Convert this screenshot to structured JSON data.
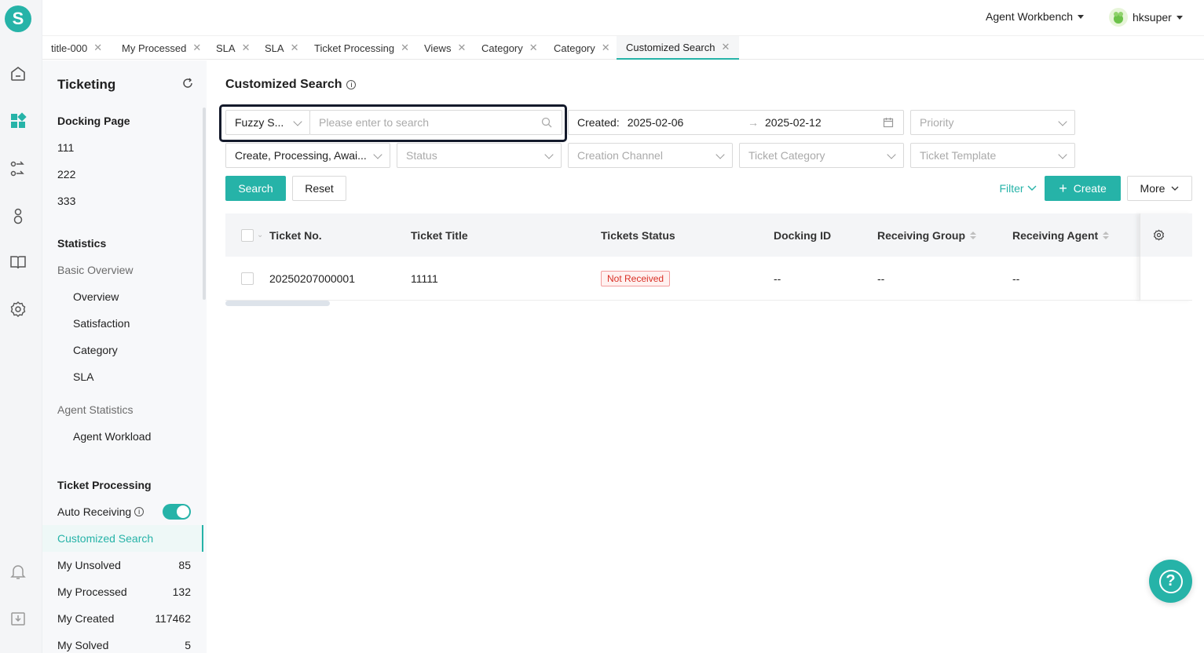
{
  "app": {
    "logo_letter": "S",
    "accent": "#26b3a8"
  },
  "header": {
    "workbench": "Agent Workbench",
    "user": "hksuper"
  },
  "tabs": [
    {
      "label": "title-000"
    },
    {
      "label": "My Processed"
    },
    {
      "label": "SLA"
    },
    {
      "label": "SLA"
    },
    {
      "label": "Ticket Processing"
    },
    {
      "label": "Views"
    },
    {
      "label": "Category"
    },
    {
      "label": "Category"
    },
    {
      "label": "Customized Search",
      "active": true
    }
  ],
  "sidebar": {
    "title": "Ticketing",
    "docking_heading": "Docking Page",
    "docking_items": [
      "111",
      "222",
      "333"
    ],
    "statistics_heading": "Statistics",
    "basic_overview": "Basic Overview",
    "basic_items": [
      "Overview",
      "Satisfaction",
      "Category",
      "SLA"
    ],
    "agent_statistics": "Agent Statistics",
    "agent_items": [
      "Agent Workload"
    ],
    "ticket_processing_heading": "Ticket Processing",
    "auto_receiving": "Auto Receiving",
    "auto_receiving_on": true,
    "active_item": "Customized Search",
    "counted_items": [
      {
        "label": "My Unsolved",
        "count": "85"
      },
      {
        "label": "My Processed",
        "count": "132"
      },
      {
        "label": "My Created",
        "count": "117462"
      },
      {
        "label": "My Solved",
        "count": "5"
      }
    ]
  },
  "main": {
    "title": "Customized Search",
    "search_type": "Fuzzy S...",
    "search_placeholder": "Please enter to search",
    "created_label": "Created",
    "created_from": "2025-02-06",
    "created_to": "2025-02-12",
    "priority_placeholder": "Priority",
    "status_filter_value": "Create, Processing, Awai...",
    "status_placeholder": "Status",
    "creation_channel_placeholder": "Creation Channel",
    "ticket_category_placeholder": "Ticket Category",
    "ticket_template_placeholder": "Ticket Template",
    "search_button": "Search",
    "reset_button": "Reset",
    "filter_button": "Filter",
    "create_button": "Create",
    "more_button": "More"
  },
  "table": {
    "columns": [
      "Ticket No.",
      "Ticket Title",
      "Tickets Status",
      "Docking ID",
      "Receiving Group",
      "Receiving Agent"
    ],
    "rows": [
      {
        "ticket_no": "20250207000001",
        "title": "11111",
        "status": "Not Received",
        "docking_id": "--",
        "group": "--",
        "agent": "--"
      }
    ]
  }
}
